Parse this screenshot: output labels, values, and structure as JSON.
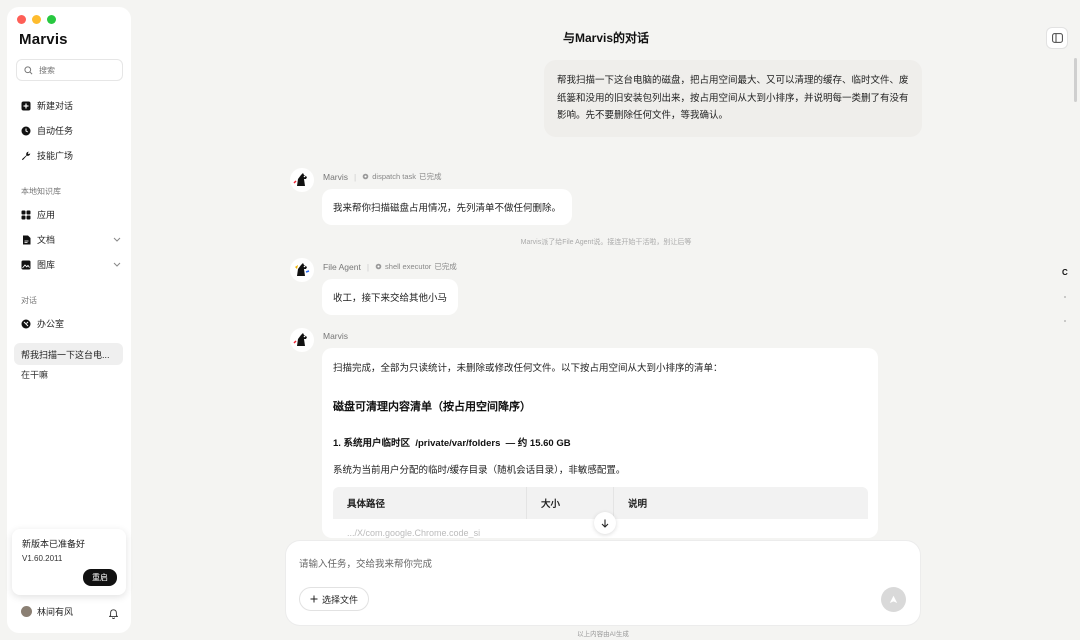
{
  "window": {
    "traffic_colors": [
      "#fe5f57",
      "#febc2e",
      "#28c840"
    ]
  },
  "sidebar": {
    "brand": "Marvis",
    "search_placeholder": "搜索",
    "primary": [
      {
        "label": "新建对话",
        "icon": "plus-square-icon"
      },
      {
        "label": "自动任务",
        "icon": "clock-icon"
      },
      {
        "label": "技能广场",
        "icon": "wrench-icon"
      }
    ],
    "kb_section": "本地知识库",
    "kb_items": [
      {
        "label": "应用",
        "icon": "grid-icon"
      },
      {
        "label": "文档",
        "icon": "document-icon"
      },
      {
        "label": "图库",
        "icon": "image-icon"
      }
    ],
    "conv_section": "对话",
    "conversations": [
      {
        "label": "办公室",
        "icon": "office-icon"
      },
      {
        "label": "帮我扫描一下这台电..."
      },
      {
        "label": "在干嘛"
      }
    ],
    "update": {
      "title": "新版本已准备好",
      "version": "V1.60.2011",
      "restart_label": "重启"
    },
    "user": {
      "name": "林间有风"
    }
  },
  "main": {
    "title": "与Marvis的对话",
    "user_message": "帮我扫描一下这台电脑的磁盘，把占用空间最大、又可以清理的缓存、临时文件、废纸篓和没用的旧安装包列出来，按占用空间从大到小排序，并说明每一类删了有没有影响。先不要删除任何文件，等我确认。",
    "messages": [
      {
        "agent": "Marvis",
        "tool": "dispatch task",
        "status": "已完成",
        "text": "我来帮你扫描磁盘占用情况，先列清单不做任何删除。"
      },
      {
        "agent": "File Agent",
        "tool": "shell executor",
        "status": "已完成",
        "text": "收工，接下来交给其他小马"
      },
      {
        "agent": "Marvis"
      }
    ],
    "system_note": "Marvis派了给File Agent说。接连开始干活啦，别让后等",
    "report": {
      "intro": "扫描完成，全部为只读统计，未删除或修改任何文件。以下按占用空间从大到小排序的清单：",
      "heading": "磁盘可清理内容清单（按占用空间降序）",
      "section1_prefix": "1. 系统用户临时区",
      "section1_path": "/private/var/folders",
      "section1_suffix": "— 约 15.60 GB",
      "section1_desc": "系统为当前用户分配的临时/缓存目录（随机会话目录），非敏感配置。",
      "columns": [
        "具体路径",
        "大小",
        "说明"
      ],
      "row_partial": [
        ".../X/com.google.Chrome.code_si",
        "",
        ""
      ]
    },
    "composer": {
      "placeholder": "请输入任务，交给我来帮你完成",
      "file_button": "选择文件"
    },
    "footer": "以上内容由AI生成",
    "right_rail_label": "C"
  }
}
